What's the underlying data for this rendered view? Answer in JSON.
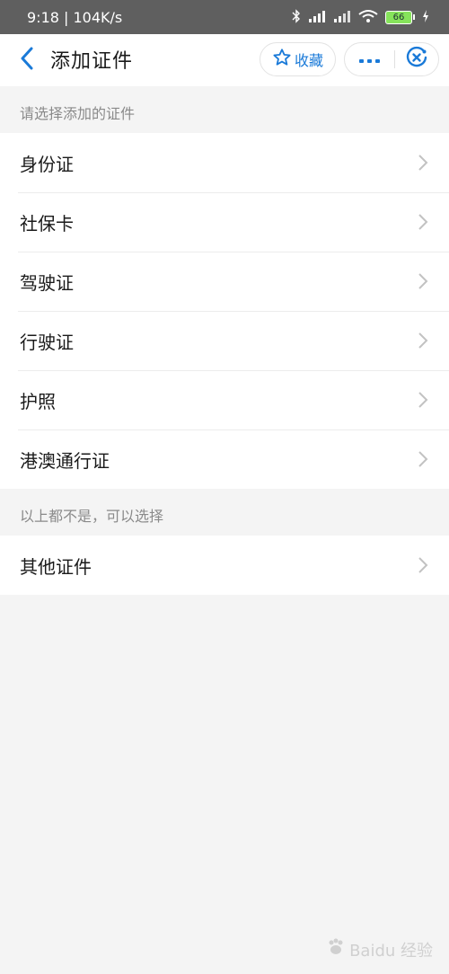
{
  "status_bar": {
    "time_speed": "9:18 | 104K/s",
    "battery": "66"
  },
  "nav": {
    "title": "添加证件",
    "favorite_label": "收藏"
  },
  "sections": [
    {
      "header": "请选择添加的证件",
      "items": [
        "身份证",
        "社保卡",
        "驾驶证",
        "行驶证",
        "护照",
        "港澳通行证"
      ]
    },
    {
      "header": "以上都不是，可以选择",
      "items": [
        "其他证件"
      ]
    }
  ],
  "watermark": "Baidu 经验",
  "colors": {
    "accent": "#1a7ad8",
    "status_bar": "#5f5f5f",
    "background": "#f4f4f4",
    "battery": "#86e35b"
  },
  "icons": {
    "back": "chevron-left-icon",
    "favorite": "star-icon",
    "more": "more-dots-icon",
    "close": "close-circle-icon",
    "row_arrow": "chevron-right-icon"
  }
}
